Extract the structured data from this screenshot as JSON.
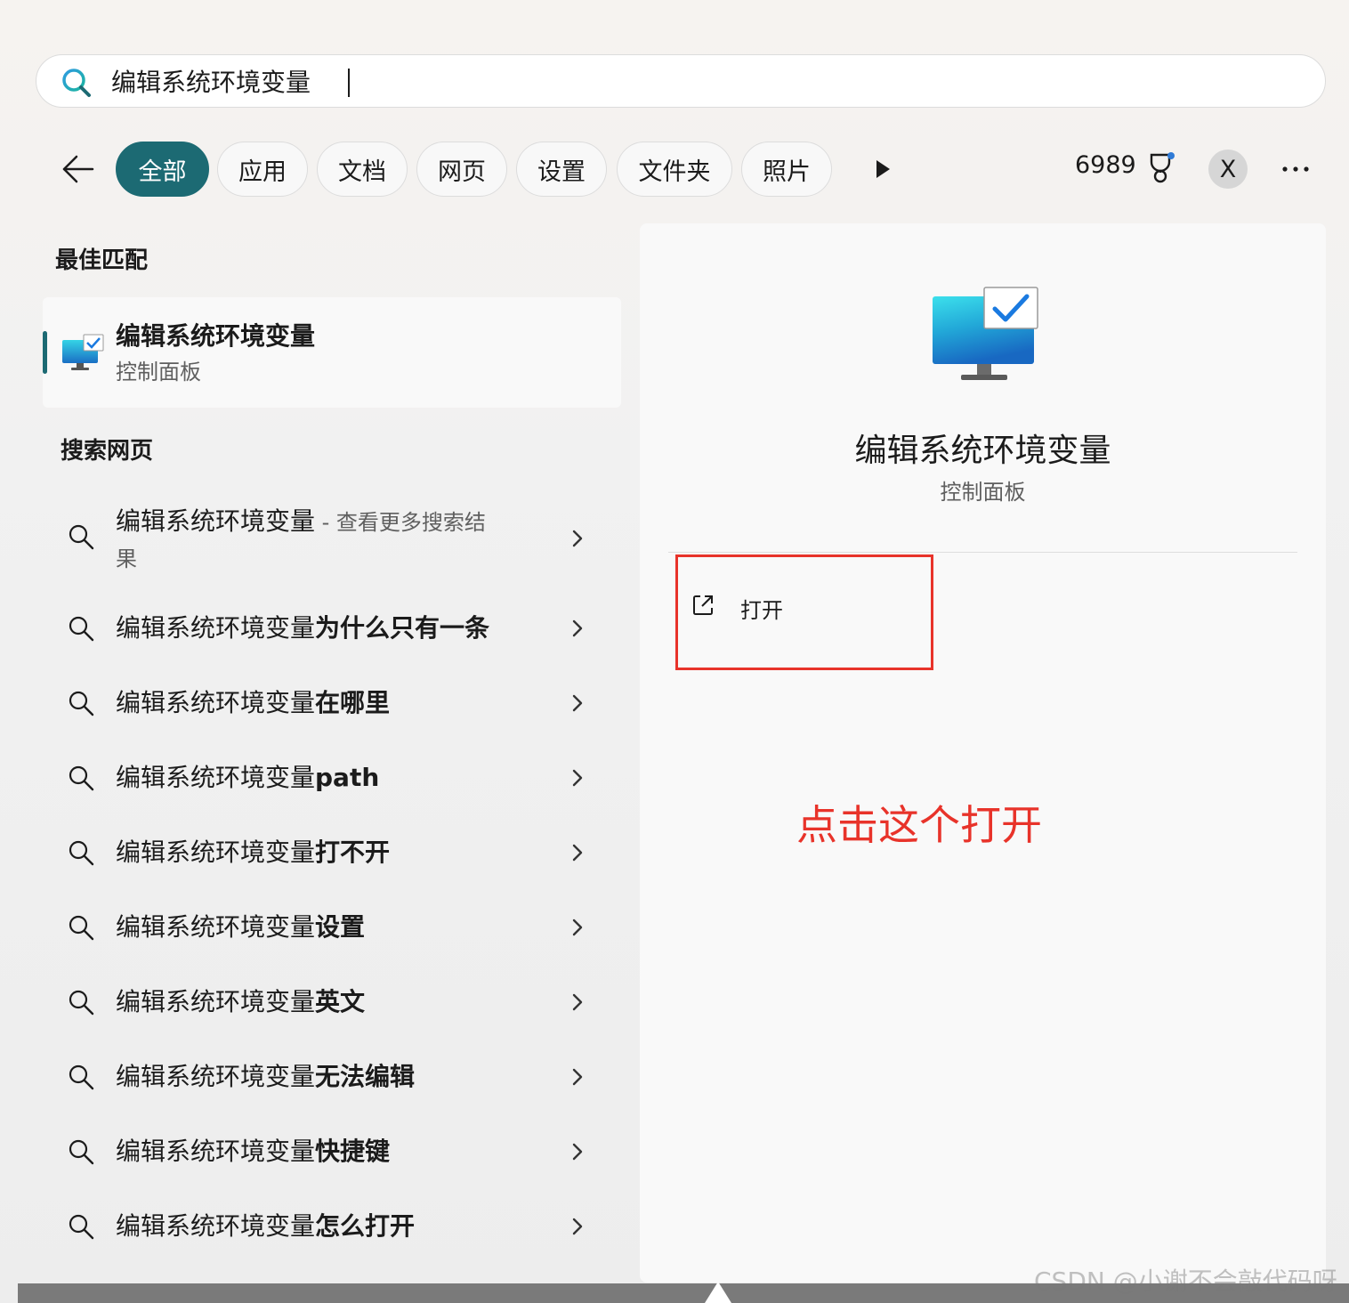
{
  "search": {
    "query": "编辑系统环境变量"
  },
  "filters": {
    "tabs": [
      {
        "label": "全部",
        "active": true
      },
      {
        "label": "应用",
        "active": false
      },
      {
        "label": "文档",
        "active": false
      },
      {
        "label": "网页",
        "active": false
      },
      {
        "label": "设置",
        "active": false
      },
      {
        "label": "文件夹",
        "active": false
      },
      {
        "label": "照片",
        "active": false
      }
    ],
    "points": "6989",
    "avatar_initial": "X"
  },
  "best_match": {
    "heading": "最佳匹配",
    "title": "编辑系统环境变量",
    "subtitle": "控制面板"
  },
  "web_search": {
    "heading": "搜索网页",
    "first": {
      "query": "编辑系统环境变量",
      "extra": " - 查看更多搜索结",
      "extra_wrap": "果"
    },
    "items": [
      {
        "base": "编辑系统环境变量",
        "suffix": "为什么只有一条"
      },
      {
        "base": "编辑系统环境变量",
        "suffix": "在哪里"
      },
      {
        "base": "编辑系统环境变量",
        "suffix": "path"
      },
      {
        "base": "编辑系统环境变量",
        "suffix": "打不开"
      },
      {
        "base": "编辑系统环境变量",
        "suffix": "设置"
      },
      {
        "base": "编辑系统环境变量",
        "suffix": "英文"
      },
      {
        "base": "编辑系统环境变量",
        "suffix": "无法编辑"
      },
      {
        "base": "编辑系统环境变量",
        "suffix": "快捷键"
      },
      {
        "base": "编辑系统环境变量",
        "suffix": "怎么打开"
      }
    ]
  },
  "detail": {
    "title": "编辑系统环境变量",
    "subtitle": "控制面板",
    "open_label": "打开"
  },
  "annotation": "点击这个打开",
  "watermark": "CSDN @小谢不会敲代码呀",
  "colors": {
    "accent": "#1c6a73",
    "annotation_red": "#e8332a"
  }
}
